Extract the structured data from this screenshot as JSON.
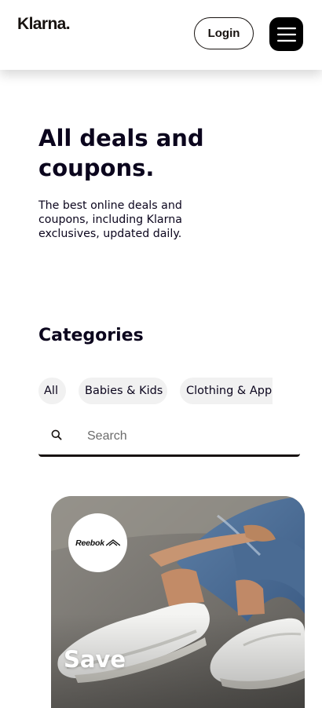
{
  "header": {
    "logo_text": "Klarna.",
    "login_label": "Login",
    "menu_icon": "hamburger-menu-icon"
  },
  "hero": {
    "title": "All deals and coupons.",
    "subtitle": "The best online deals and coupons, including Klarna exclusives, updated daily."
  },
  "categories": {
    "title": "Categories",
    "chips": [
      {
        "label": "All",
        "selected": true
      },
      {
        "label": "Babies & Kids",
        "selected": false
      },
      {
        "label": "Clothing & Apparel",
        "selected": false
      }
    ]
  },
  "search": {
    "placeholder": "Search",
    "value": "",
    "icon": "search-icon"
  },
  "deal_card": {
    "brand": "Reebok",
    "headline": "Save"
  }
}
